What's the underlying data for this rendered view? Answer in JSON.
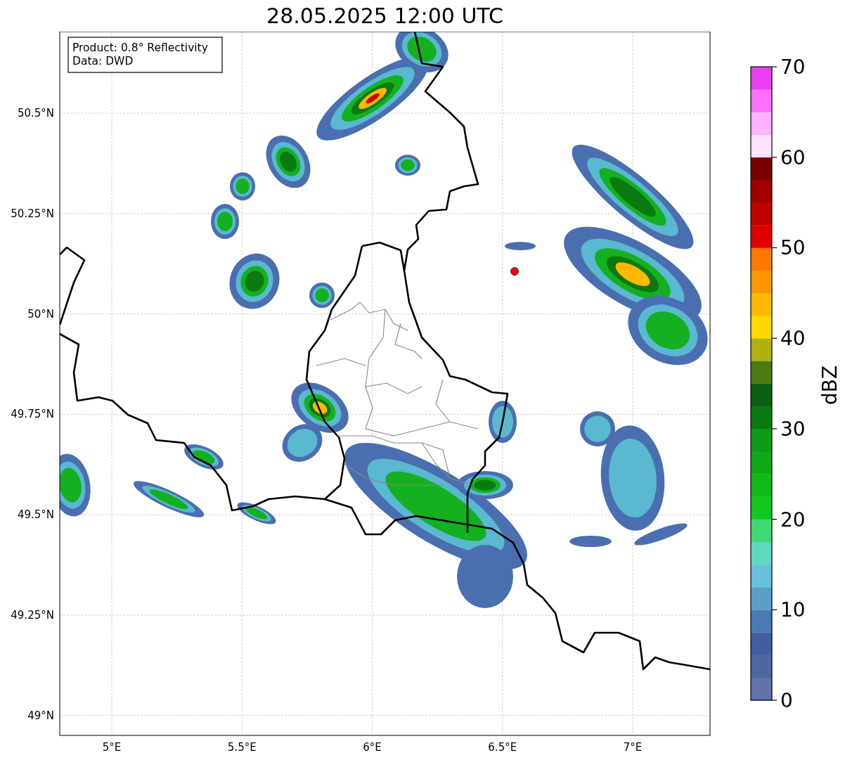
{
  "title": "28.05.2025 12:00 UTC",
  "info_box": {
    "lines": [
      "Product: 0.8° Reflectivity",
      "Data: DWD"
    ]
  },
  "map": {
    "y_ticks": [
      "50.5°N",
      "50.25°N",
      "50°N",
      "49.75°N",
      "49.5°N",
      "49.25°N",
      "49°N"
    ],
    "x_ticks": [
      "5°E",
      "5.5°E",
      "6°E",
      "6.5°E",
      "7°E"
    ]
  },
  "colorbar": {
    "label": "dBZ",
    "ticks": [
      "70",
      "60",
      "50",
      "40",
      "30",
      "20",
      "10",
      "0"
    ],
    "bins": [
      {
        "color": "#6272a8"
      },
      {
        "color": "#5066a0"
      },
      {
        "color": "#405ea0"
      },
      {
        "color": "#4a7ab4"
      },
      {
        "color": "#5a9ec8"
      },
      {
        "color": "#68c0dc"
      },
      {
        "color": "#60d8c0"
      },
      {
        "color": "#40d870"
      },
      {
        "color": "#10c820"
      },
      {
        "color": "#10b818"
      },
      {
        "color": "#10a818"
      },
      {
        "color": "#109818"
      },
      {
        "color": "#0a7a10"
      },
      {
        "color": "#0a6010"
      },
      {
        "color": "#4a7a10"
      },
      {
        "color": "#b0b010"
      },
      {
        "color": "#ffd800"
      },
      {
        "color": "#ffb800"
      },
      {
        "color": "#ff9800"
      },
      {
        "color": "#ff7800"
      },
      {
        "color": "#e00000"
      },
      {
        "color": "#c00000"
      },
      {
        "color": "#a00000"
      },
      {
        "color": "#780000"
      },
      {
        "color": "#ffe0ff"
      },
      {
        "color": "#ffb0ff"
      },
      {
        "color": "#ff70ff"
      },
      {
        "color": "#e840f0"
      }
    ]
  }
}
